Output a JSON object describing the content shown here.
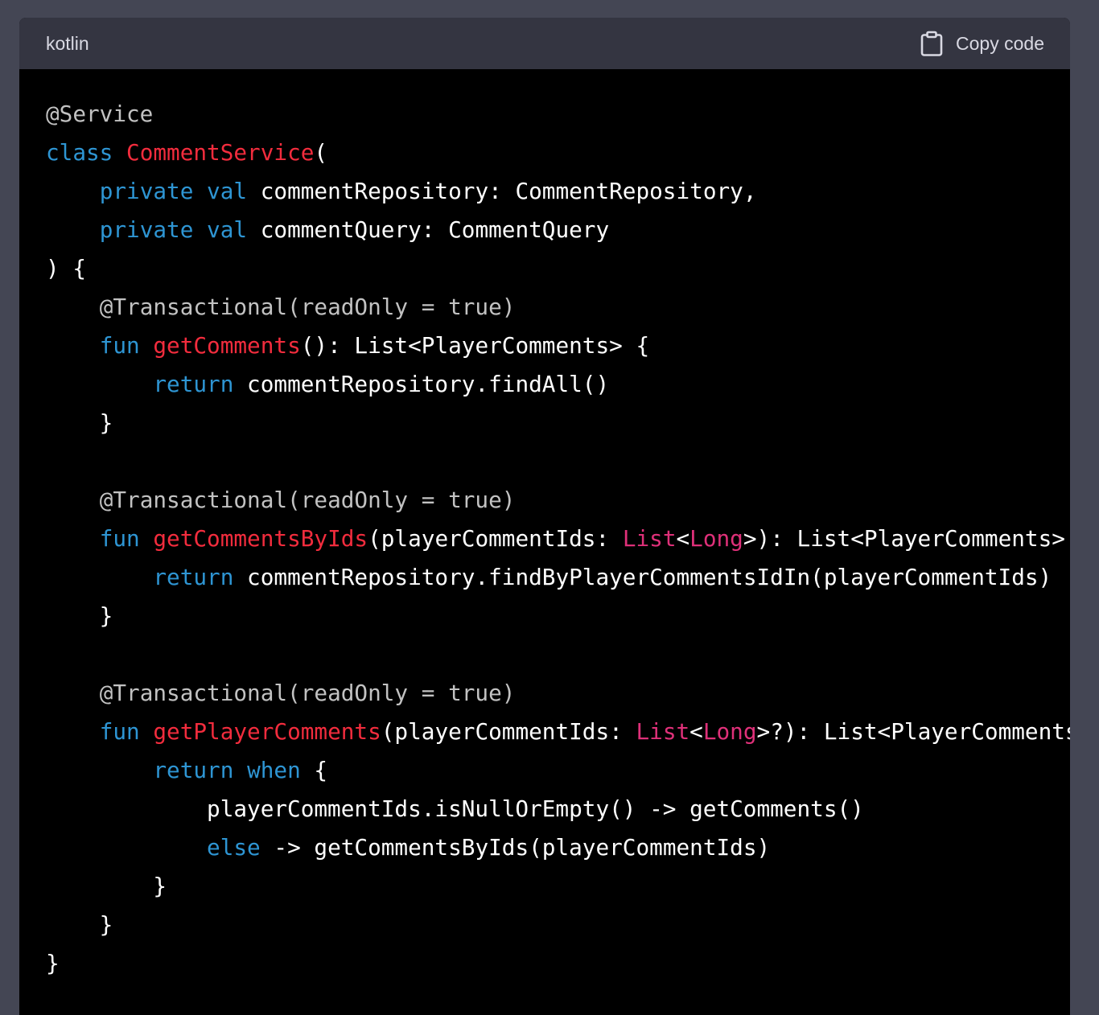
{
  "header": {
    "language": "kotlin",
    "copy_label": "Copy code"
  },
  "colors": {
    "page_background": "#444654",
    "header_background": "#343541",
    "code_background": "#000000",
    "plain": "#ffffff",
    "keyword": "#2e95d3",
    "title": "#f22c3d",
    "annotation": "#c2c2c2",
    "builtin": "#df3079"
  },
  "code": {
    "lines": [
      [
        {
          "t": "annotation",
          "v": "@Service"
        }
      ],
      [
        {
          "t": "keyword",
          "v": "class"
        },
        {
          "t": "plain",
          "v": " "
        },
        {
          "t": "title",
          "v": "CommentService"
        },
        {
          "t": "plain",
          "v": "("
        }
      ],
      [
        {
          "t": "plain",
          "v": "    "
        },
        {
          "t": "keyword",
          "v": "private"
        },
        {
          "t": "plain",
          "v": " "
        },
        {
          "t": "keyword",
          "v": "val"
        },
        {
          "t": "plain",
          "v": " commentRepository: CommentRepository,"
        }
      ],
      [
        {
          "t": "plain",
          "v": "    "
        },
        {
          "t": "keyword",
          "v": "private"
        },
        {
          "t": "plain",
          "v": " "
        },
        {
          "t": "keyword",
          "v": "val"
        },
        {
          "t": "plain",
          "v": " commentQuery: CommentQuery"
        }
      ],
      [
        {
          "t": "plain",
          "v": ") {"
        }
      ],
      [
        {
          "t": "plain",
          "v": "    "
        },
        {
          "t": "annotation",
          "v": "@Transactional(readOnly = true)"
        }
      ],
      [
        {
          "t": "plain",
          "v": "    "
        },
        {
          "t": "keyword",
          "v": "fun"
        },
        {
          "t": "plain",
          "v": " "
        },
        {
          "t": "title",
          "v": "getComments"
        },
        {
          "t": "plain",
          "v": "(): List<PlayerComments> {"
        }
      ],
      [
        {
          "t": "plain",
          "v": "        "
        },
        {
          "t": "keyword",
          "v": "return"
        },
        {
          "t": "plain",
          "v": " commentRepository.findAll()"
        }
      ],
      [
        {
          "t": "plain",
          "v": "    }"
        }
      ],
      [
        {
          "t": "plain",
          "v": ""
        }
      ],
      [
        {
          "t": "plain",
          "v": "    "
        },
        {
          "t": "annotation",
          "v": "@Transactional(readOnly = true)"
        }
      ],
      [
        {
          "t": "plain",
          "v": "    "
        },
        {
          "t": "keyword",
          "v": "fun"
        },
        {
          "t": "plain",
          "v": " "
        },
        {
          "t": "title",
          "v": "getCommentsByIds"
        },
        {
          "t": "plain",
          "v": "(playerCommentIds: "
        },
        {
          "t": "builtin",
          "v": "List"
        },
        {
          "t": "plain",
          "v": "<"
        },
        {
          "t": "builtin",
          "v": "Long"
        },
        {
          "t": "plain",
          "v": ">): List<PlayerComments> {"
        }
      ],
      [
        {
          "t": "plain",
          "v": "        "
        },
        {
          "t": "keyword",
          "v": "return"
        },
        {
          "t": "plain",
          "v": " commentRepository.findByPlayerCommentsIdIn(playerCommentIds)"
        }
      ],
      [
        {
          "t": "plain",
          "v": "    }"
        }
      ],
      [
        {
          "t": "plain",
          "v": ""
        }
      ],
      [
        {
          "t": "plain",
          "v": "    "
        },
        {
          "t": "annotation",
          "v": "@Transactional(readOnly = true)"
        }
      ],
      [
        {
          "t": "plain",
          "v": "    "
        },
        {
          "t": "keyword",
          "v": "fun"
        },
        {
          "t": "plain",
          "v": " "
        },
        {
          "t": "title",
          "v": "getPlayerComments"
        },
        {
          "t": "plain",
          "v": "(playerCommentIds: "
        },
        {
          "t": "builtin",
          "v": "List"
        },
        {
          "t": "plain",
          "v": "<"
        },
        {
          "t": "builtin",
          "v": "Long"
        },
        {
          "t": "plain",
          "v": ">?): List<PlayerComments> {"
        }
      ],
      [
        {
          "t": "plain",
          "v": "        "
        },
        {
          "t": "keyword",
          "v": "return"
        },
        {
          "t": "plain",
          "v": " "
        },
        {
          "t": "keyword",
          "v": "when"
        },
        {
          "t": "plain",
          "v": " {"
        }
      ],
      [
        {
          "t": "plain",
          "v": "            playerCommentIds.isNullOrEmpty() -> getComments()"
        }
      ],
      [
        {
          "t": "plain",
          "v": "            "
        },
        {
          "t": "keyword",
          "v": "else"
        },
        {
          "t": "plain",
          "v": " -> getCommentsByIds(playerCommentIds)"
        }
      ],
      [
        {
          "t": "plain",
          "v": "        }"
        }
      ],
      [
        {
          "t": "plain",
          "v": "    }"
        }
      ],
      [
        {
          "t": "plain",
          "v": "}"
        }
      ]
    ]
  }
}
